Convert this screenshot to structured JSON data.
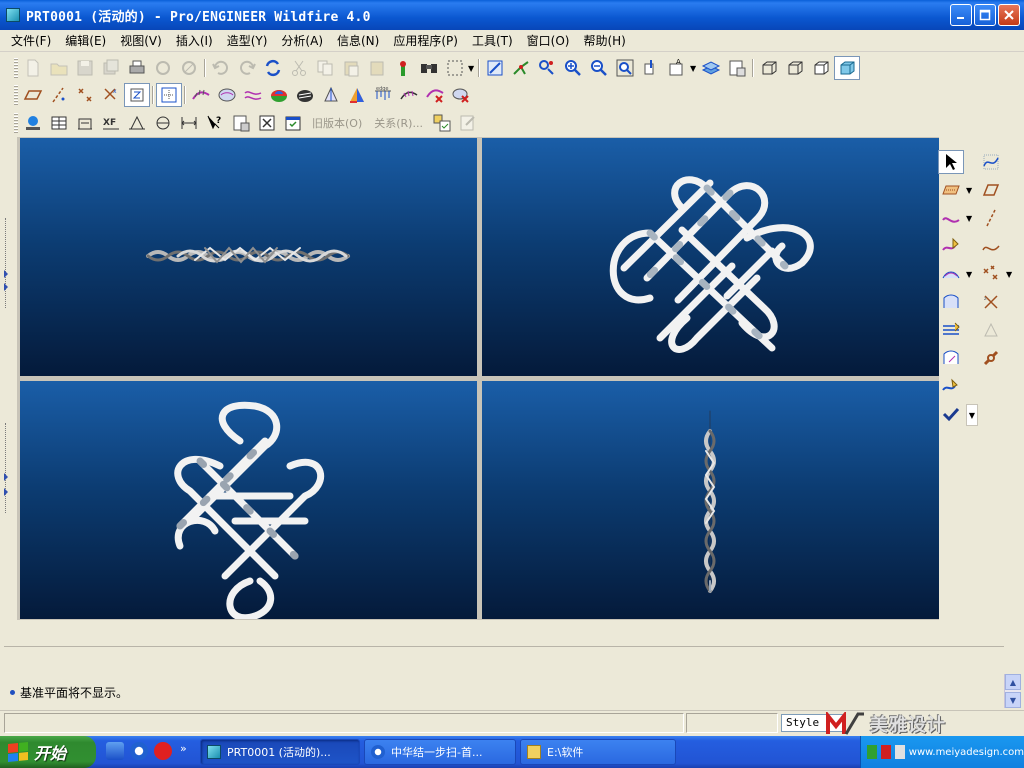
{
  "window": {
    "title": "PRT0001 (活动的) - Pro/ENGINEER Wildfire 4.0",
    "controls": [
      "minimize",
      "maximize",
      "close"
    ]
  },
  "menu": {
    "items": [
      "文件(F)",
      "编辑(E)",
      "视图(V)",
      "插入(I)",
      "造型(Y)",
      "分析(A)",
      "信息(N)",
      "应用程序(P)",
      "工具(T)",
      "窗口(O)",
      "帮助(H)"
    ]
  },
  "toolbar3": {
    "old_version_label": "旧版本(O)",
    "relations_label": "关系(R)..."
  },
  "message_area": {
    "message": "基准平面将不显示。"
  },
  "statusbar": {
    "style_value": "Style",
    "watermark_text": "美雅设计",
    "watermark_url": "www.meiyadesign.com"
  },
  "taskbar": {
    "start_label": "开始",
    "more_label": "»",
    "tasks": [
      {
        "label": "PRT0001 (活动的)..."
      },
      {
        "label": "中华结一步扫-首..."
      },
      {
        "label": "E:\\软件"
      }
    ]
  },
  "colors": {
    "viewport_top": "#1a5ea8",
    "viewport_bottom": "#041a3a",
    "titlebar": "#0a57d0",
    "taskbar": "#245ee0",
    "start_green": "#318f31"
  }
}
